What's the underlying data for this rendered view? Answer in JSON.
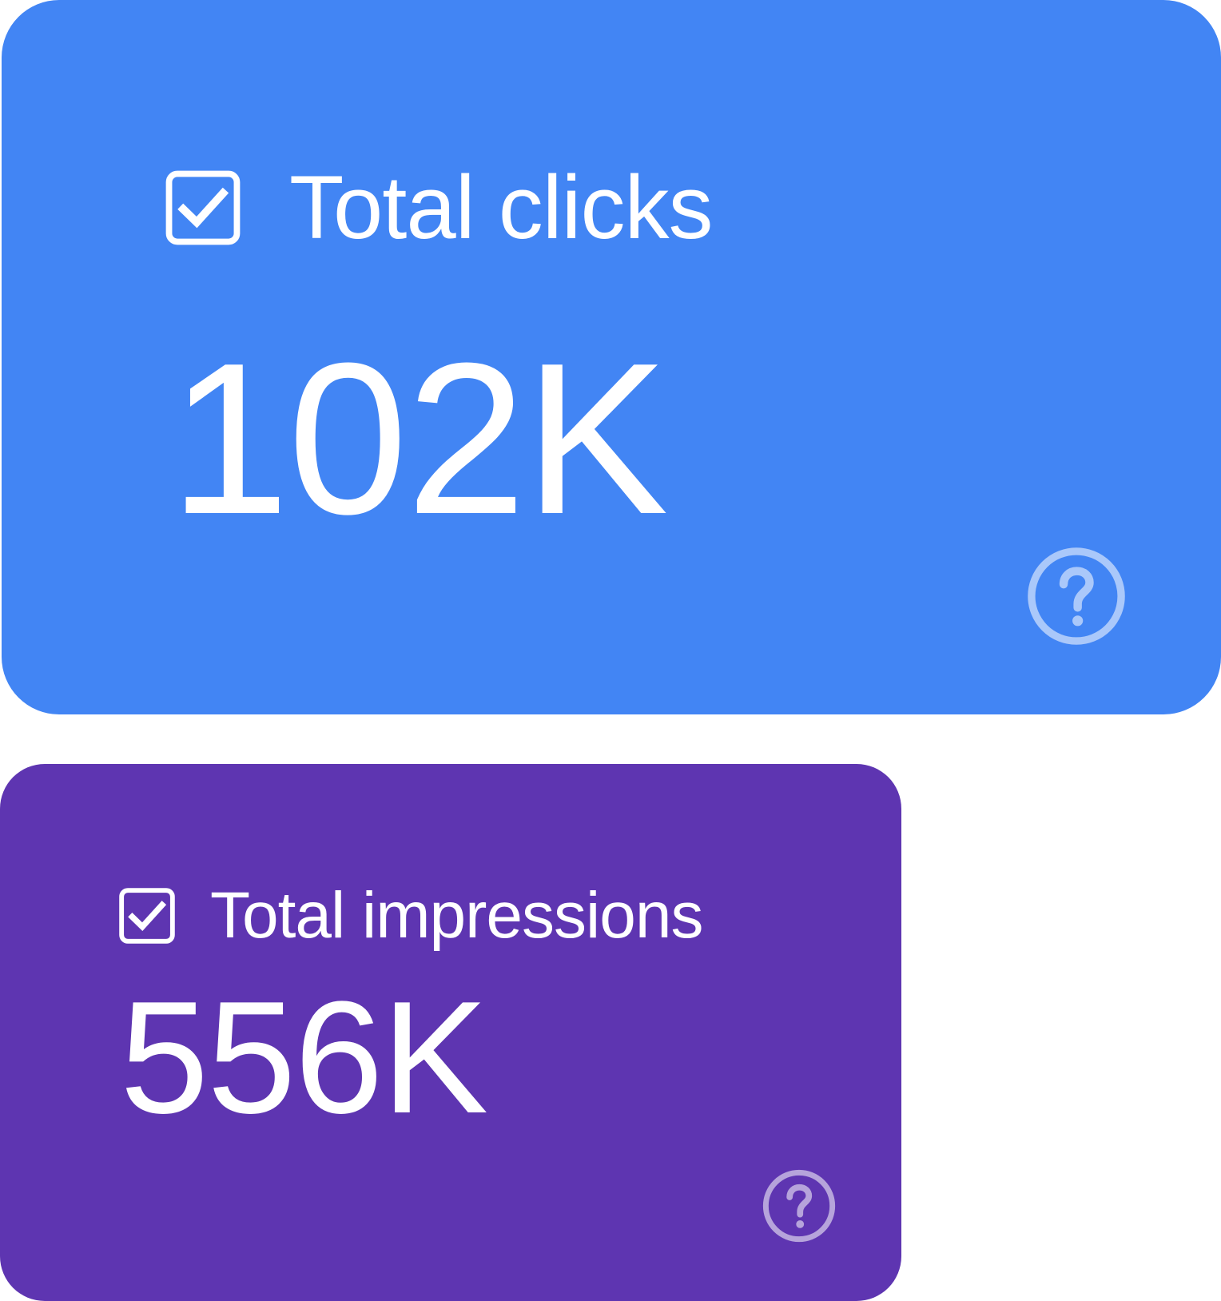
{
  "cards": [
    {
      "label": "Total clicks",
      "value": "102K",
      "checked": true,
      "color": "#4285f4"
    },
    {
      "label": "Total impressions",
      "value": "556K",
      "checked": true,
      "color": "#5e35b1"
    }
  ],
  "icons": {
    "checkbox": "checkbox-checked-icon",
    "help": "help-circle-icon"
  }
}
